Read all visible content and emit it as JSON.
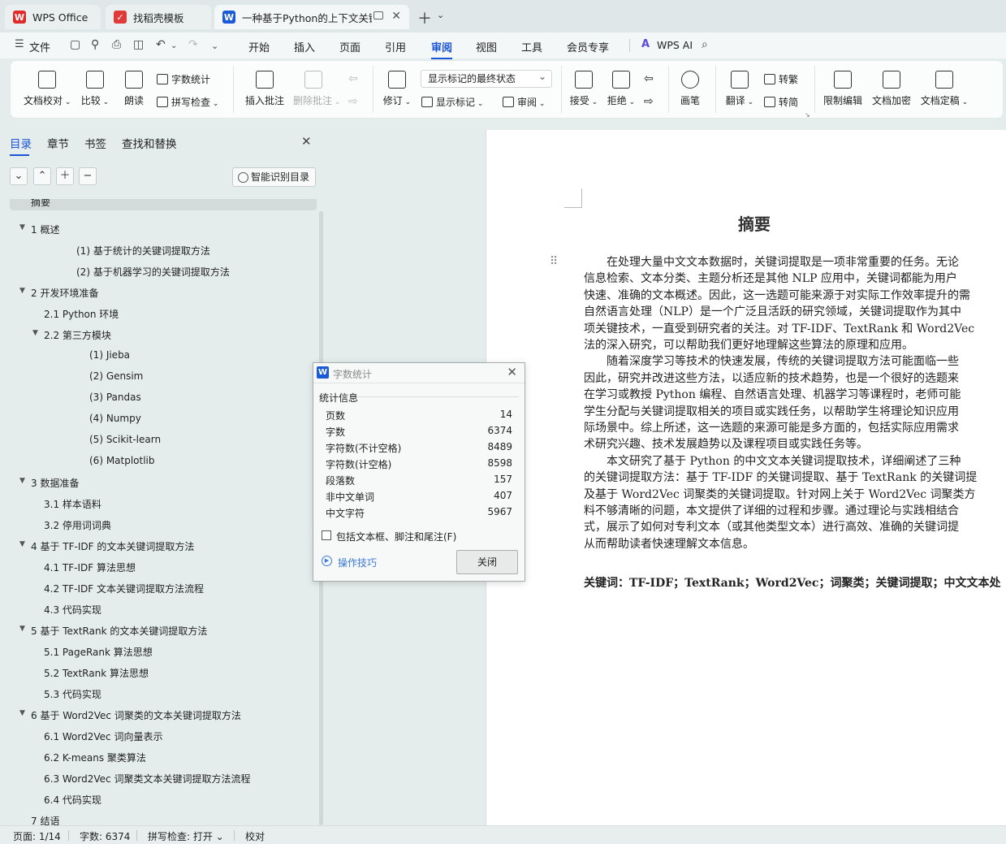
{
  "tabs": [
    {
      "label": "WPS Office"
    },
    {
      "label": "找稻壳模板"
    },
    {
      "label": "一种基于Python的上下文关键"
    }
  ],
  "menu": {
    "file": "文件",
    "items": [
      "开始",
      "插入",
      "页面",
      "引用",
      "审阅",
      "视图",
      "工具",
      "会员专享"
    ],
    "ai": "WPS AI",
    "active": "审阅"
  },
  "ribbon": {
    "proofread": "文档校对",
    "compare": "比较",
    "read": "朗读",
    "wordcount": "字数统计",
    "spellcheck": "拼写检查",
    "insert_comment": "插入批注",
    "delete_comment": "删除批注",
    "revise": "修订",
    "markup_dropdown": "显示标记的最终状态",
    "show_markup": "显示标记",
    "review": "审阅",
    "accept": "接受",
    "reject": "拒绝",
    "pen": "画笔",
    "translate": "翻译",
    "to_trad": "转繁",
    "to_simp": "转简",
    "restrict": "限制编辑",
    "encrypt": "文档加密",
    "finalize": "文档定稿"
  },
  "nav": {
    "tabs": [
      "目录",
      "章节",
      "书签",
      "查找和替换"
    ],
    "smart_toc": "智能识别目录",
    "toc": [
      {
        "text": "摘要"
      },
      {
        "text": "1 概述"
      },
      {
        "text": "(1) 基于统计的关键词提取方法"
      },
      {
        "text": "(2) 基于机器学习的关键词提取方法"
      },
      {
        "text": "2 开发环境准备"
      },
      {
        "text": "2.1 Python 环境"
      },
      {
        "text": "2.2 第三方模块"
      },
      {
        "text": "(1) Jieba"
      },
      {
        "text": "(2) Gensim"
      },
      {
        "text": "(3) Pandas"
      },
      {
        "text": "(4) Numpy"
      },
      {
        "text": "(5) Scikit-learn"
      },
      {
        "text": "(6) Matplotlib"
      },
      {
        "text": "3 数据准备"
      },
      {
        "text": "3.1 样本语料"
      },
      {
        "text": "3.2 停用词词典"
      },
      {
        "text": "4 基于 TF-IDF 的文本关键词提取方法"
      },
      {
        "text": "4.1 TF-IDF 算法思想"
      },
      {
        "text": "4.2 TF-IDF 文本关键词提取方法流程"
      },
      {
        "text": "4.3 代码实现"
      },
      {
        "text": "5 基于 TextRank 的文本关键词提取方法"
      },
      {
        "text": "5.1 PageRank 算法思想"
      },
      {
        "text": "5.2 TextRank 算法思想"
      },
      {
        "text": "5.3 代码实现"
      },
      {
        "text": "6 基于 Word2Vec 词聚类的文本关键词提取方法"
      },
      {
        "text": "6.1 Word2Vec 词向量表示"
      },
      {
        "text": "6.2 K-means 聚类算法"
      },
      {
        "text": "6.3 Word2Vec 词聚类文本关键词提取方法流程"
      },
      {
        "text": "6.4 代码实现"
      },
      {
        "text": "7 结语"
      }
    ]
  },
  "doc": {
    "title": "摘要",
    "lines": [
      "　　在处理大量中文文本数据时，关键词提取是一项非常重要的任务。无论",
      "信息检索、文本分类、主题分析还是其他 NLP 应用中，关键词都能为用户",
      "快速、准确的文本概述。因此，这一选题可能来源于对实际工作效率提升的需",
      "自然语言处理（NLP）是一个广泛且活跃的研究领域，关键词提取作为其中",
      "项关键技术，一直受到研究者的关注。对 TF-IDF、TextRank 和 Word2Vec",
      "法的深入研究，可以帮助我们更好地理解这些算法的原理和应用。",
      "　　随着深度学习等技术的快速发展，传统的关键词提取方法可能面临一些",
      "因此，研究并改进这些方法，以适应新的技术趋势，也是一个很好的选题来",
      "在学习或教授 Python 编程、自然语言处理、机器学习等课程时，老师可能",
      "学生分配与关键词提取相关的项目或实践任务，以帮助学生将理论知识应用",
      "际场景中。综上所述，这一选题的来源可能是多方面的，包括实际应用需求",
      "术研究兴趣、技术发展趋势以及课程项目或实践任务等。",
      "　　本文研究了基于 Python 的中文文本关键词提取技术，详细阐述了三种",
      "的关键词提取方法：基于 TF-IDF 的关键词提取、基于 TextRank 的关键词提",
      "及基于 Word2Vec 词聚类的关键词提取。针对网上关于 Word2Vec 词聚类方",
      "料不够清晰的问题，本文提供了详细的过程和步骤。通过理论与实践相结合",
      "式，展示了如何对专利文本（或其他类型文本）进行高效、准确的关键词提",
      "从而帮助读者快速理解文本信息。"
    ],
    "keywords": "关键词：TF-IDF；TextRank；Word2Vec；词聚类；关键词提取；中文文本处"
  },
  "dialog": {
    "title": "字数统计",
    "section": "统计信息",
    "stats": [
      {
        "label": "页数",
        "value": "14"
      },
      {
        "label": "字数",
        "value": "6374"
      },
      {
        "label": "字符数(不计空格)",
        "value": "8489"
      },
      {
        "label": "字符数(计空格)",
        "value": "8598"
      },
      {
        "label": "段落数",
        "value": "157"
      },
      {
        "label": "非中文单词",
        "value": "407"
      },
      {
        "label": "中文字符",
        "value": "5967"
      }
    ],
    "checkbox": "包括文本框、脚注和尾注(F)",
    "tips": "操作技巧",
    "close": "关闭"
  },
  "status": {
    "page": "页面: 1/14",
    "words": "字数: 6374",
    "spell": "拼写检查: 打开 ⌄",
    "proof": "校对"
  }
}
